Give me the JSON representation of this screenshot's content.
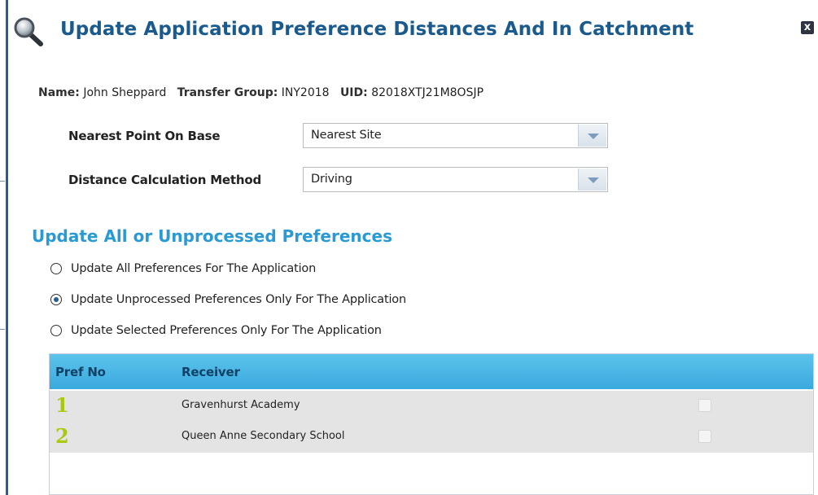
{
  "dialog": {
    "title": "Update Application Preference Distances And In Catchment",
    "title_icon": "magnifier-icon",
    "close_icon": "close-icon",
    "close_glyph": "x"
  },
  "applicant": {
    "name_label": "Name:",
    "name_value": "John Sheppard",
    "group_label": "Transfer Group:",
    "group_value": "INY2018",
    "uid_label": "UID:",
    "uid_value": "82018XTJ21M8OSJP"
  },
  "fields": {
    "nearest_point": {
      "label": "Nearest Point On Base",
      "value": "Nearest Site"
    },
    "distance_method": {
      "label": "Distance Calculation Method",
      "value": "Driving"
    }
  },
  "section": {
    "heading": "Update All or Unprocessed Preferences",
    "options": [
      {
        "label": "Update All Preferences For The Application",
        "checked": false
      },
      {
        "label": "Update Unprocessed Preferences Only For The Application",
        "checked": true
      },
      {
        "label": "Update Selected Preferences Only For The Application",
        "checked": false
      }
    ]
  },
  "table": {
    "headers": {
      "pref_no": "Pref No",
      "receiver": "Receiver"
    },
    "rows": [
      {
        "pref_no": "1",
        "receiver": "Gravenhurst Academy",
        "selected": false
      },
      {
        "pref_no": "2",
        "receiver": "Queen Anne Secondary School",
        "selected": false
      }
    ]
  },
  "colors": {
    "title": "#1a5a8c",
    "section_heading": "#2a9ad4",
    "table_header": "#4ab6e6",
    "pref_number": "#a9c90f",
    "row_background": "#e4e4e4"
  }
}
